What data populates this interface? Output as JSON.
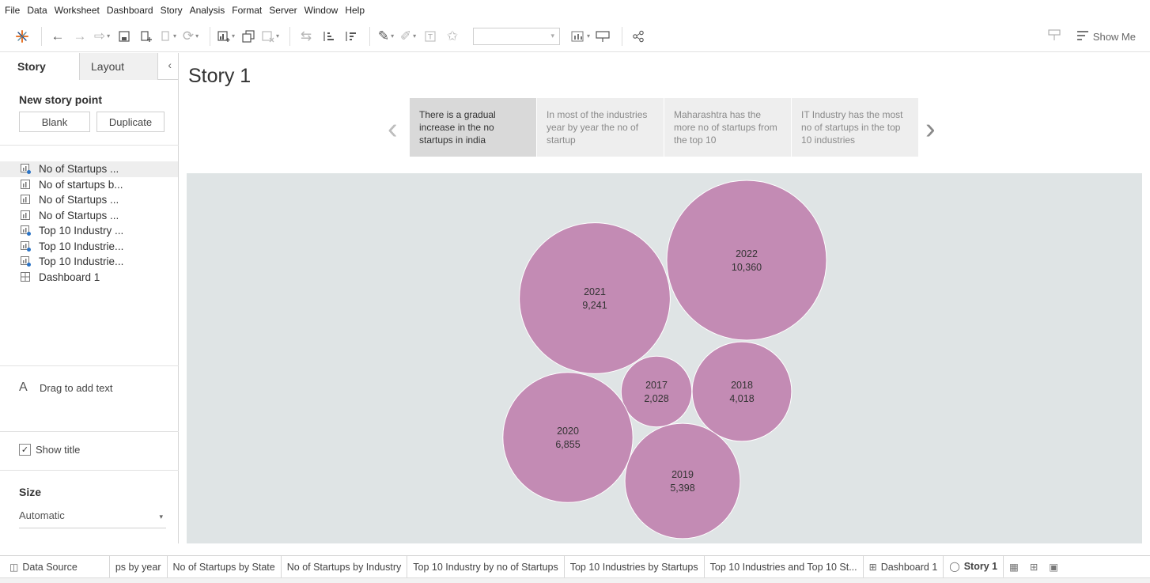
{
  "menu": [
    "File",
    "Data",
    "Worksheet",
    "Dashboard",
    "Story",
    "Analysis",
    "Format",
    "Server",
    "Window",
    "Help"
  ],
  "toolbar": {
    "show_me_label": "Show Me"
  },
  "left_panel": {
    "tabs": {
      "story": "Story",
      "layout": "Layout"
    },
    "new_story_point_title": "New story point",
    "blank_label": "Blank",
    "duplicate_label": "Duplicate",
    "sheets": [
      {
        "label": "No of Startups ...",
        "icon": "chart-used-icon"
      },
      {
        "label": "No of startups b...",
        "icon": "chart-icon"
      },
      {
        "label": "No of Startups ...",
        "icon": "chart-icon"
      },
      {
        "label": "No of Startups ...",
        "icon": "chart-icon"
      },
      {
        "label": "Top 10 Industry ...",
        "icon": "chart-used-icon"
      },
      {
        "label": "Top 10 Industrie...",
        "icon": "chart-used-icon"
      },
      {
        "label": "Top 10 Industrie...",
        "icon": "chart-used-icon"
      },
      {
        "label": "Dashboard 1",
        "icon": "dashboard-icon"
      }
    ],
    "drag_text": "Drag to add text",
    "show_title_label": "Show title",
    "size_title": "Size",
    "size_value": "Automatic"
  },
  "story": {
    "title": "Story 1",
    "captions": [
      "There is a gradual increase in the no startups in india",
      "In most of the industries year by year the no of startup",
      "Maharashtra  has the more no of startups from the top 10",
      "IT Industry has the most no of startups in the top 10 industries"
    ],
    "active_caption": 0
  },
  "chart_data": {
    "type": "bubble",
    "color": "#c38bb4",
    "background": "#dfe4e5",
    "points": [
      {
        "year": "2017",
        "value": 2028,
        "label": "2,028"
      },
      {
        "year": "2018",
        "value": 4018,
        "label": "4,018"
      },
      {
        "year": "2019",
        "value": 5398,
        "label": "5,398"
      },
      {
        "year": "2020",
        "value": 6855,
        "label": "6,855"
      },
      {
        "year": "2021",
        "value": 9241,
        "label": "9,241"
      },
      {
        "year": "2022",
        "value": 10360,
        "label": "10,360"
      }
    ]
  },
  "bottom_tabs": {
    "data_source": "Data Source",
    "sheets": [
      "ps by year",
      "No of Startups by State",
      "No of Startups by Industry",
      "Top 10 Industry by no of Startups",
      "Top 10 Industries by Startups",
      "Top 10 Industries and Top 10 St..."
    ],
    "dashboard": "Dashboard 1",
    "story": "Story 1"
  }
}
